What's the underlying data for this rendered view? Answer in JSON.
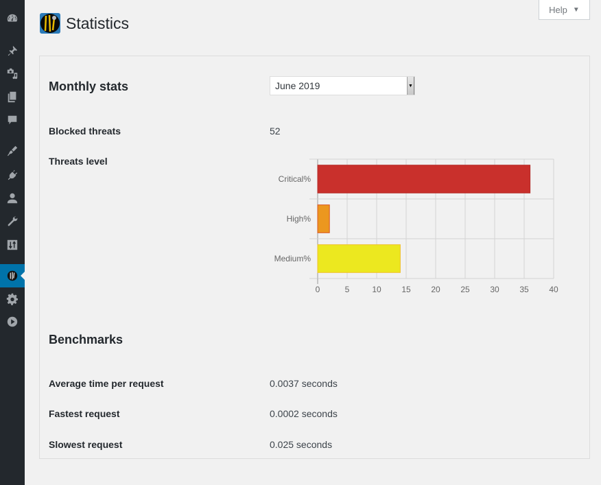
{
  "sidebar": {
    "items": [
      {
        "icon": "dashboard-icon",
        "active": false
      },
      {
        "icon": "pin-icon",
        "active": false
      },
      {
        "icon": "media-icon",
        "active": false
      },
      {
        "icon": "pages-icon",
        "active": false
      },
      {
        "icon": "comments-icon",
        "active": false
      },
      {
        "icon": "appearance-brush-icon",
        "active": false
      },
      {
        "icon": "plugins-icon",
        "active": false
      },
      {
        "icon": "users-icon",
        "active": false
      },
      {
        "icon": "tools-wrench-icon",
        "active": false
      },
      {
        "icon": "settings-sliders-icon",
        "active": false
      },
      {
        "icon": "plugin-logo-icon",
        "active": true
      },
      {
        "icon": "gear-icon",
        "active": false
      },
      {
        "icon": "play-icon",
        "active": false
      }
    ]
  },
  "header": {
    "title": "Statistics",
    "help_label": "Help",
    "help_caret": "▼"
  },
  "monthly": {
    "title": "Monthly stats",
    "selected_month": "June 2019",
    "select_arrow": "▼",
    "blocked_label": "Blocked threats",
    "blocked_value": "52",
    "level_label": "Threats level"
  },
  "chart_data": {
    "type": "bar",
    "orientation": "horizontal",
    "categories": [
      "Critical%",
      "High%",
      "Medium%"
    ],
    "values": [
      36,
      2,
      14
    ],
    "colors": [
      "#c9302c",
      "#ec971f",
      "#ece81f"
    ],
    "border_colors": [
      "#b52b27",
      "#d9541e",
      "#f0c02a"
    ],
    "xticks": [
      "0",
      "5",
      "10",
      "15",
      "20",
      "25",
      "30",
      "35",
      "40"
    ],
    "xlim": [
      0,
      40
    ],
    "grid": true,
    "title": "",
    "xlabel": "",
    "ylabel": ""
  },
  "benchmarks": {
    "title": "Benchmarks",
    "rows": [
      {
        "label": "Average time per request",
        "value": "0.0037 seconds"
      },
      {
        "label": "Fastest request",
        "value": "0.0002 seconds"
      },
      {
        "label": "Slowest request",
        "value": "0.025 seconds"
      }
    ]
  }
}
